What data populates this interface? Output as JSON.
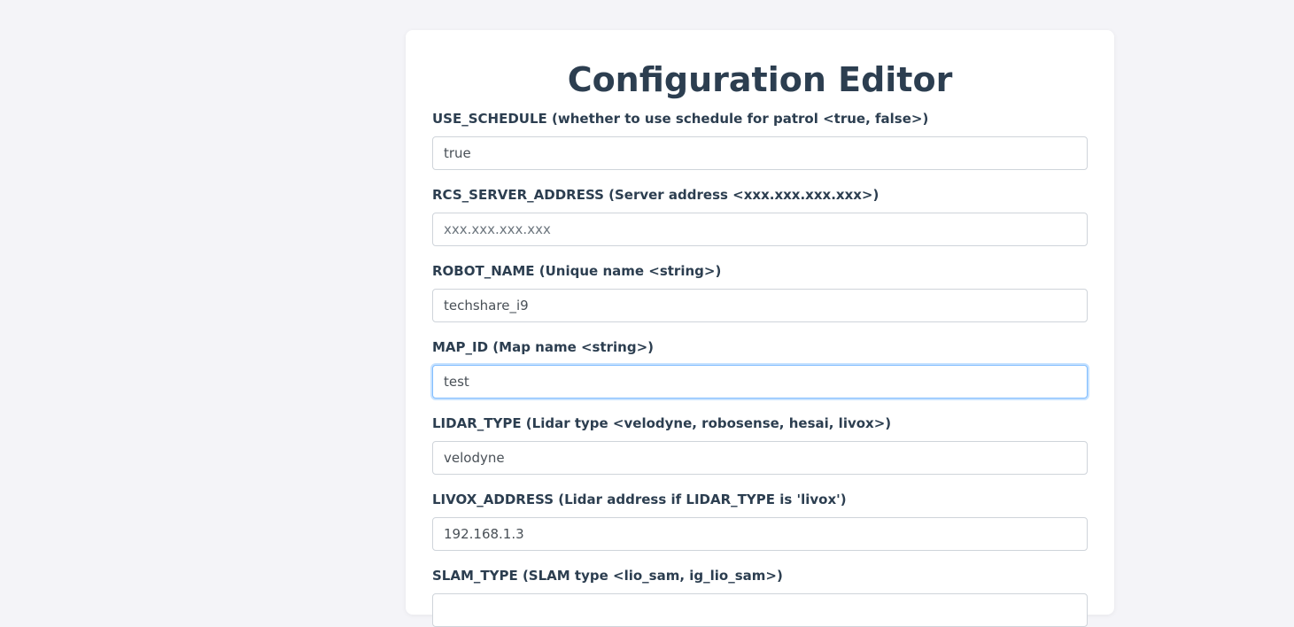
{
  "page": {
    "title": "Configuration Editor"
  },
  "fields": [
    {
      "label": "USE_SCHEDULE (whether to use schedule for patrol <true, false>)",
      "value": "true",
      "placeholder": ""
    },
    {
      "label": "RCS_SERVER_ADDRESS (Server address <xxx.xxx.xxx.xxx>)",
      "value": "",
      "placeholder": "xxx.xxx.xxx.xxx"
    },
    {
      "label": "ROBOT_NAME (Unique name <string>)",
      "value": "techshare_i9",
      "placeholder": ""
    },
    {
      "label": "MAP_ID (Map name <string>)",
      "value": "test",
      "placeholder": "",
      "focused": true
    },
    {
      "label": "LIDAR_TYPE (Lidar type <velodyne, robosense, hesai, livox>)",
      "value": "velodyne",
      "placeholder": ""
    },
    {
      "label": "LIVOX_ADDRESS (Lidar address if LIDAR_TYPE is 'livox')",
      "value": "192.168.1.3",
      "placeholder": ""
    },
    {
      "label": "SLAM_TYPE (SLAM type <lio_sam, ig_lio_sam>)",
      "value": "",
      "placeholder": ""
    }
  ],
  "colors": {
    "background": "#f4f4f8",
    "card": "#ffffff",
    "heading": "#2c3e50",
    "focus_border": "#80bdff"
  }
}
